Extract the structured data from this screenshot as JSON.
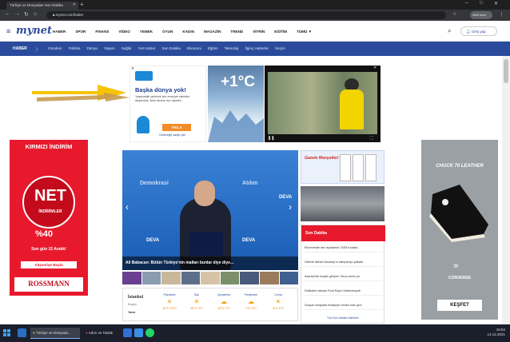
{
  "browser": {
    "tab_title": "Türkiye ve Dünyadan Son Dakika",
    "address": "mynet.com/haber",
    "profile_label": "Gizli mod"
  },
  "site": {
    "logo": "mynet",
    "top_nav": [
      "HABER",
      "SPOR",
      "FİNANS",
      "VİDEO",
      "YEMEK",
      "OYUN",
      "KADIN",
      "MAGAZİN",
      "TREND",
      "VİTRİN",
      "EĞİTİM",
      "TÜMÜ ▼"
    ],
    "login_label": "Giriş yap",
    "category_home": "HABER",
    "category_links": [
      "Gündem",
      "Politika",
      "Dünya",
      "Yaşam",
      "Sağlık",
      "Yurt Haber",
      "Son Dakika",
      "Ekonomi",
      "Eğitim",
      "Teknoloji",
      "İlginç Haberler",
      "Seçim"
    ]
  },
  "top_ad": {
    "title": "Başka dünya yok!",
    "subtitle": "Yaşanabilir gelecek için emeriye sahiden düşündük, iklim krizine dur diyelim.",
    "button": "TIKLA",
    "footer": "Geleceğe sahip çık!",
    "temperature": "+1°C"
  },
  "left_ad": {
    "headline": "KIRMIZI İNDİRİM",
    "big": "NET",
    "sub": "İNDİRİMLER",
    "percent": "%40",
    "date": "Son gün 15 Aralık!",
    "cta": "Alışverişe Başla",
    "brand": "ROSSMANN"
  },
  "right_ad": {
    "headline": "CHUCK 70 LEATHER",
    "brand": "CONVERSE",
    "cta": "KEŞFET"
  },
  "slider": {
    "caption": "Ali Babacan: Bütün Türkiye'nin malları bunlar diye diye...",
    "bg_words": [
      "Demokrasi",
      "Atılım"
    ],
    "logo": "DEVA"
  },
  "weather": {
    "city": "İstanbul",
    "city_day": "Bugün",
    "city_next": "Yarın",
    "days": [
      {
        "name": "Pazartesi",
        "temp": "14°C 10°C"
      },
      {
        "name": "Salı",
        "temp": "16°C 9°C"
      },
      {
        "name": "Çarşamba",
        "temp": "14°C 7°C"
      },
      {
        "name": "Perşembe",
        "temp": "7°C 4°C"
      },
      {
        "name": "Cuma",
        "temp": "8°C 4°C"
      }
    ]
  },
  "right_column": {
    "gazete_title": "Gazete Manşetleri",
    "son_dakika_title": "Son Dakika",
    "items": [
      "Ekonomide dev açıklama! 2030'a kadar...",
      "Ülkede İlkesel Aksaray'ın kampanyu patladı",
      "Asansörde bıçaklı girişim! Genç kadın ya",
      "Deliksinir talepte Fırat Kayın Mahkumiyeti",
      "Sosyal medyada endişeye neden olan gün"
    ],
    "more": "Tüm Son Dakika Haberleri"
  },
  "taskbar": {
    "items": [
      "Türkiye ve Dünyada...",
      "Adım ve Taslak"
    ],
    "clock": "16:54",
    "date": "14.12.2021"
  }
}
